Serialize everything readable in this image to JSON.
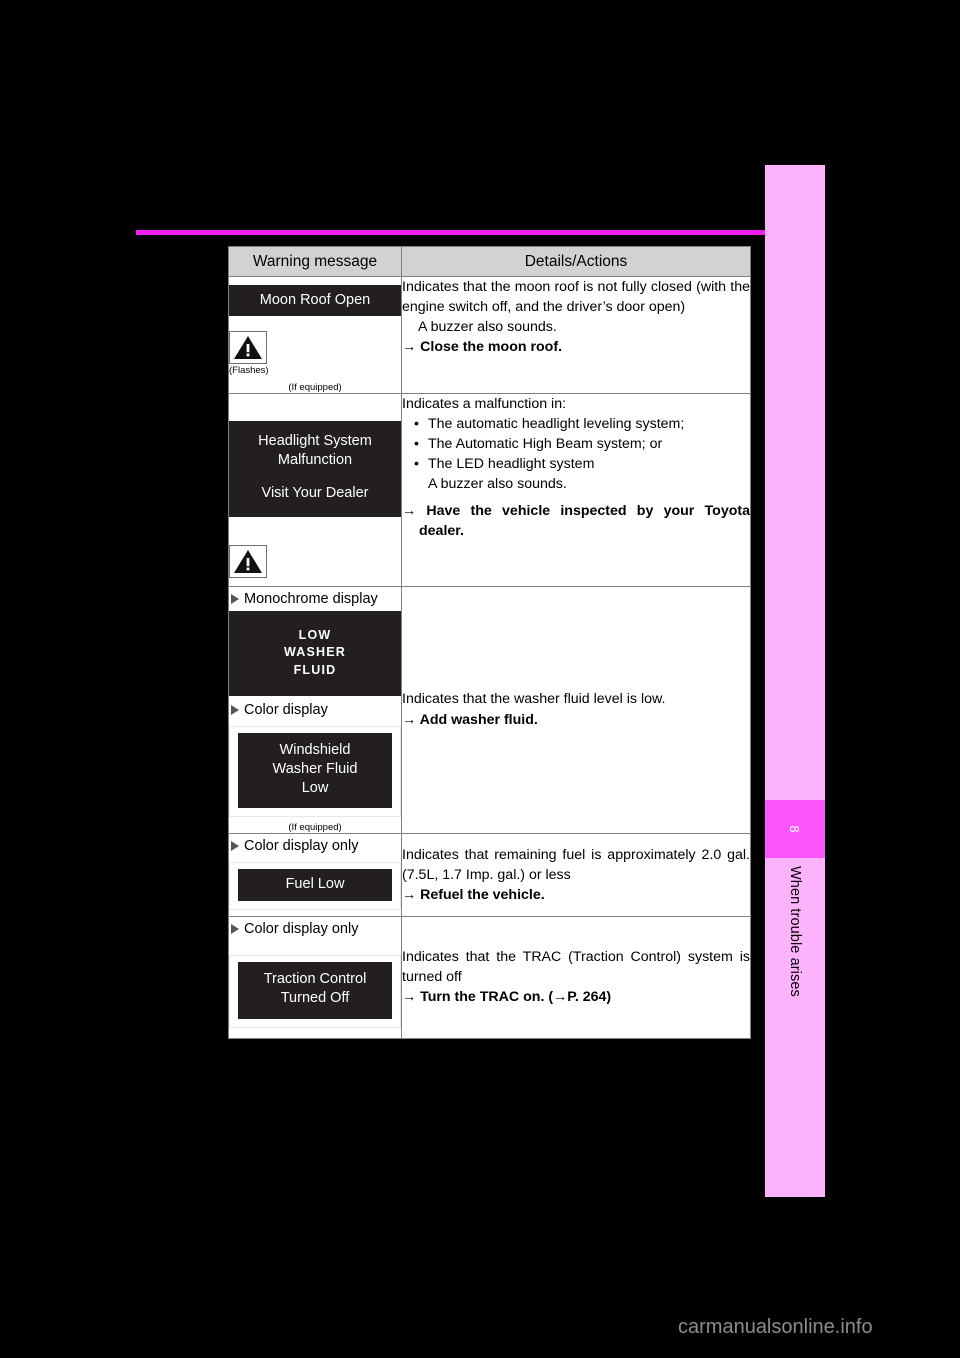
{
  "page": {
    "number": "8",
    "section_title": "When trouble arises",
    "watermark": "carmanualsonline.info"
  },
  "table": {
    "headers": {
      "col1": "Warning message",
      "col2": "Details/Actions"
    },
    "rows": [
      {
        "id": "moon-roof-open",
        "display_text": "Moon Roof Open",
        "icon_caption": "(Flashes)",
        "equipped_note": "(If equipped)",
        "details_lines": [
          "Indicates that the moon roof is not fully closed (with the engine switch off, and the driver’s door open)",
          "A buzzer also sounds."
        ],
        "action": "→ Close the moon roof."
      },
      {
        "id": "headlight-system-malfunction",
        "display_line1": "Headlight System",
        "display_line2": "Malfunction",
        "display_line3": "Visit Your Dealer",
        "details_intro": "Indicates a malfunction in:",
        "details_bullets": [
          "The automatic headlight leveling system;",
          "The Automatic High Beam system; or",
          "The LED headlight system"
        ],
        "details_note": "A buzzer also sounds.",
        "action": "→ Have the vehicle inspected by your Toyota dealer."
      },
      {
        "id": "washer-fluid-low",
        "sub_head_mono": "Monochrome display",
        "mono_display_line1": "LOW",
        "mono_display_line2": "WASHER",
        "mono_display_line3": "FLUID",
        "sub_head_color": "Color display",
        "color_display_line1": "Windshield",
        "color_display_line2": "Washer Fluid",
        "color_display_line3": "Low",
        "equipped_note": "(If equipped)",
        "details": "Indicates that the washer fluid level is low.",
        "action": "→ Add washer fluid."
      },
      {
        "id": "fuel-low",
        "sub_head": "Color display only",
        "display_text": "Fuel Low",
        "details": "Indicates that remaining fuel is approximately 2.0 gal. (7.5L, 1.7 Imp. gal.) or less",
        "action": "→ Refuel the vehicle."
      },
      {
        "id": "traction-control-turned-off",
        "sub_head": "Color display only",
        "display_line1": "Traction Control",
        "display_line2": "Turned Off",
        "details": "Indicates that the TRAC (Traction Control) system is turned off",
        "action": "→ Turn the TRAC on. (→P. 264)"
      }
    ]
  },
  "colors": {
    "tab_pink": "#fcb3fc",
    "tab_pink_dark": "#fc55fc",
    "rule_magenta": "#f01ef0",
    "display_panel": "#231f20",
    "header_gray": "#d2d2d2"
  }
}
